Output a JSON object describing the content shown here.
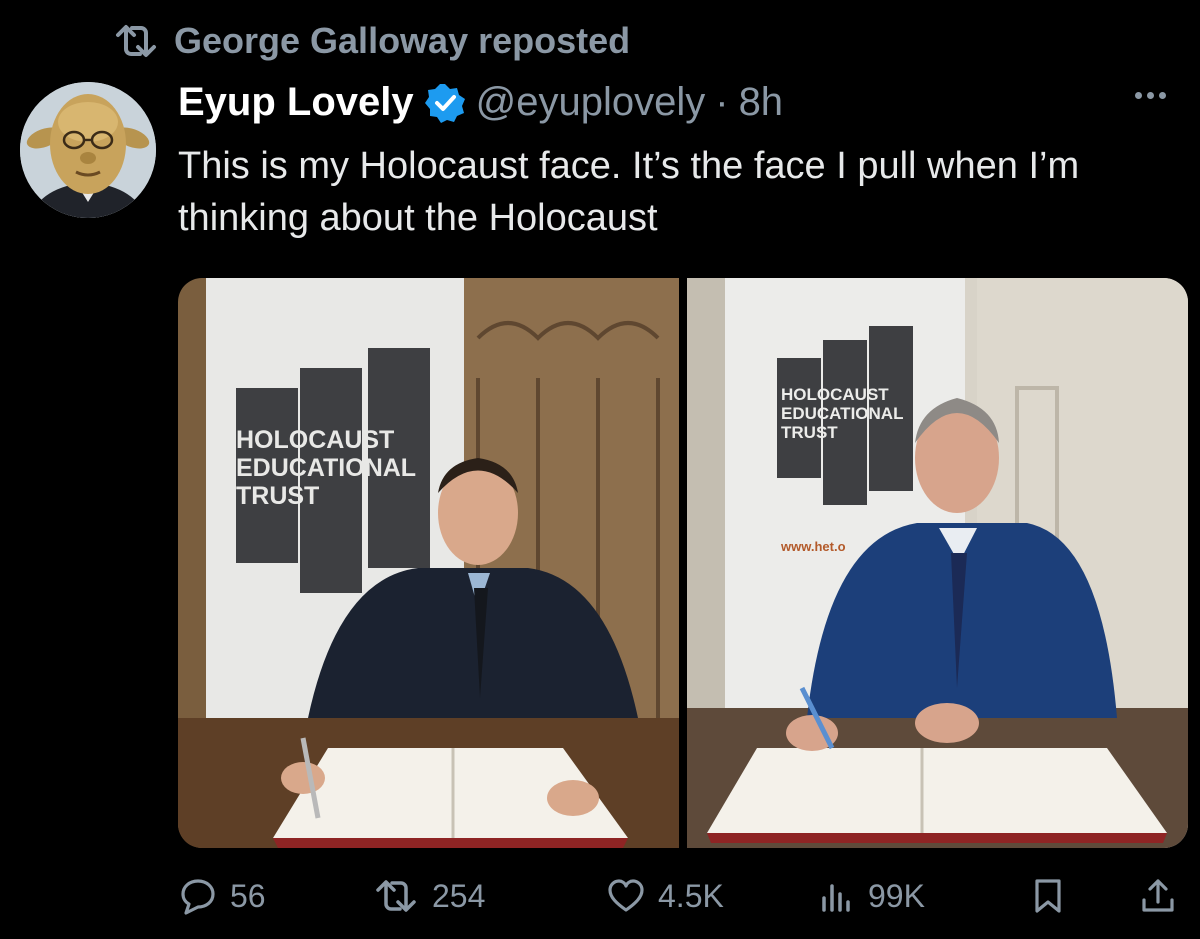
{
  "repost": {
    "label": "George Galloway reposted"
  },
  "author": {
    "name": "Eyup Lovely",
    "handle": "@eyuplovely",
    "separator": "·",
    "time": "8h"
  },
  "tweet": {
    "text": "This is my Holocaust face. It’s the face I pull when I’m thinking about the Holocaust"
  },
  "media": {
    "left_banner": {
      "line1": "HOLOCAUST",
      "line2": "EDUCATIONAL",
      "line3": "TRUST"
    },
    "right_banner": {
      "line1": "HOLOCAUST",
      "line2": "EDUCATIONAL",
      "line3": "TRUST",
      "url": "www.het.o"
    }
  },
  "actions": {
    "replies": "56",
    "reposts": "254",
    "likes": "4.5K",
    "views": "99K"
  },
  "colors": {
    "background": "#000000",
    "muted": "#8b98a5",
    "verified": "#1d9bf0",
    "text": "#e7e9ea"
  },
  "icons": {
    "repost_header": "repost-icon",
    "verified": "verified-badge-icon",
    "more": "more-options-icon",
    "reply": "reply-icon",
    "repost": "repost-icon",
    "like": "heart-icon",
    "views": "views-icon",
    "bookmark": "bookmark-icon",
    "share": "share-icon"
  }
}
